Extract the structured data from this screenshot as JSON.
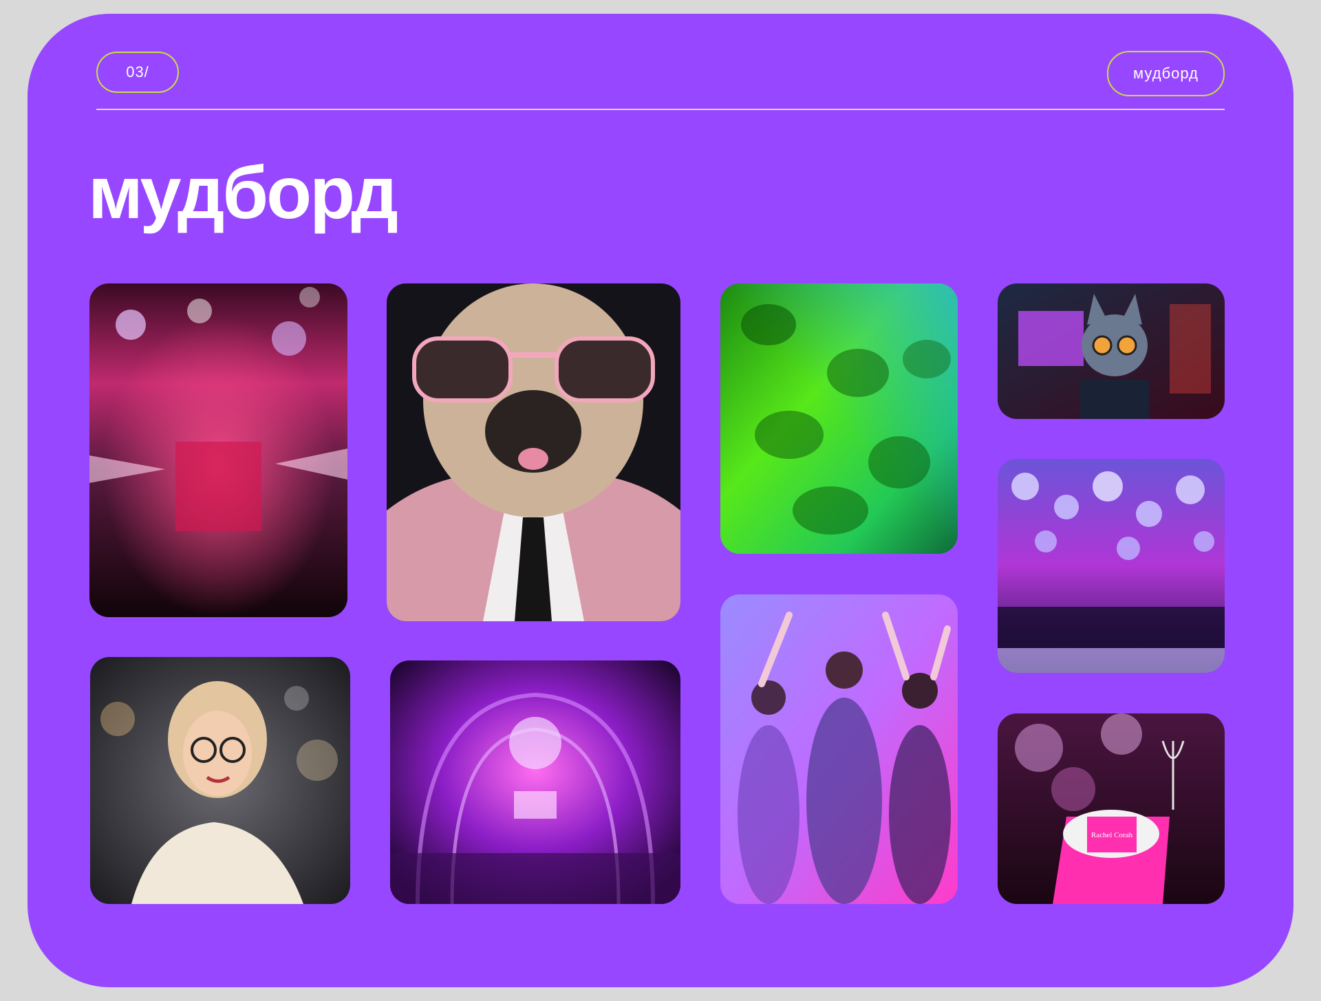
{
  "header": {
    "page_number": "03/",
    "section_tag": "мудборд"
  },
  "title": "мудборд",
  "images": [
    {
      "id": "party-hall-pink",
      "subject": "pink party hall with disco balls"
    },
    {
      "id": "pug-sunglasses",
      "subject": "pug in sunglasses and suit"
    },
    {
      "id": "green-crystals",
      "subject": "green crystal spheres"
    },
    {
      "id": "cyber-cat",
      "subject": "cat with glasses at computer"
    },
    {
      "id": "woman-3d",
      "subject": "3D cartoon woman in white suit"
    },
    {
      "id": "disco-tunnel",
      "subject": "purple disco tunnel with crowd"
    },
    {
      "id": "dancing-people",
      "subject": "people dancing in purple light"
    },
    {
      "id": "silver-balloons-hall",
      "subject": "hall with silver balloons"
    },
    {
      "id": "table-setting",
      "subject": "pink table setting with disco balls",
      "place_card_text": "Rachel Corah"
    }
  ]
}
